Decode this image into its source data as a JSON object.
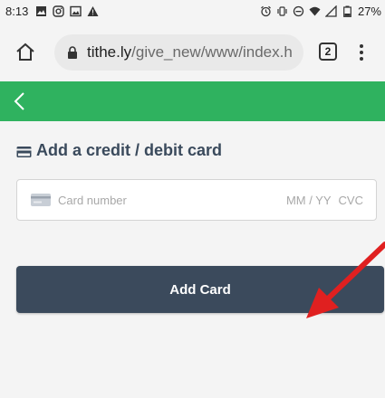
{
  "status_bar": {
    "time": "8:13",
    "battery": "27%",
    "left_icons": [
      "image-icon",
      "instagram-icon",
      "gallery-icon",
      "warning-icon"
    ],
    "right_icons": [
      "alarm-icon",
      "vibrate-icon",
      "dnd-icon",
      "wifi-icon",
      "signal-icon",
      "battery-icon"
    ]
  },
  "browser": {
    "url_host": "tithe.ly",
    "url_path": "/give_new/www/index.h",
    "tab_count": "2"
  },
  "page": {
    "section_title": "Add a credit / debit card",
    "card_number_placeholder": "Card number",
    "expiry_placeholder": "MM / YY",
    "cvc_placeholder": "CVC",
    "add_card_label": "Add Card"
  },
  "colors": {
    "header_green": "#2fb25f",
    "button_bg": "#3b4a5c",
    "arrow_red": "#e02020"
  }
}
